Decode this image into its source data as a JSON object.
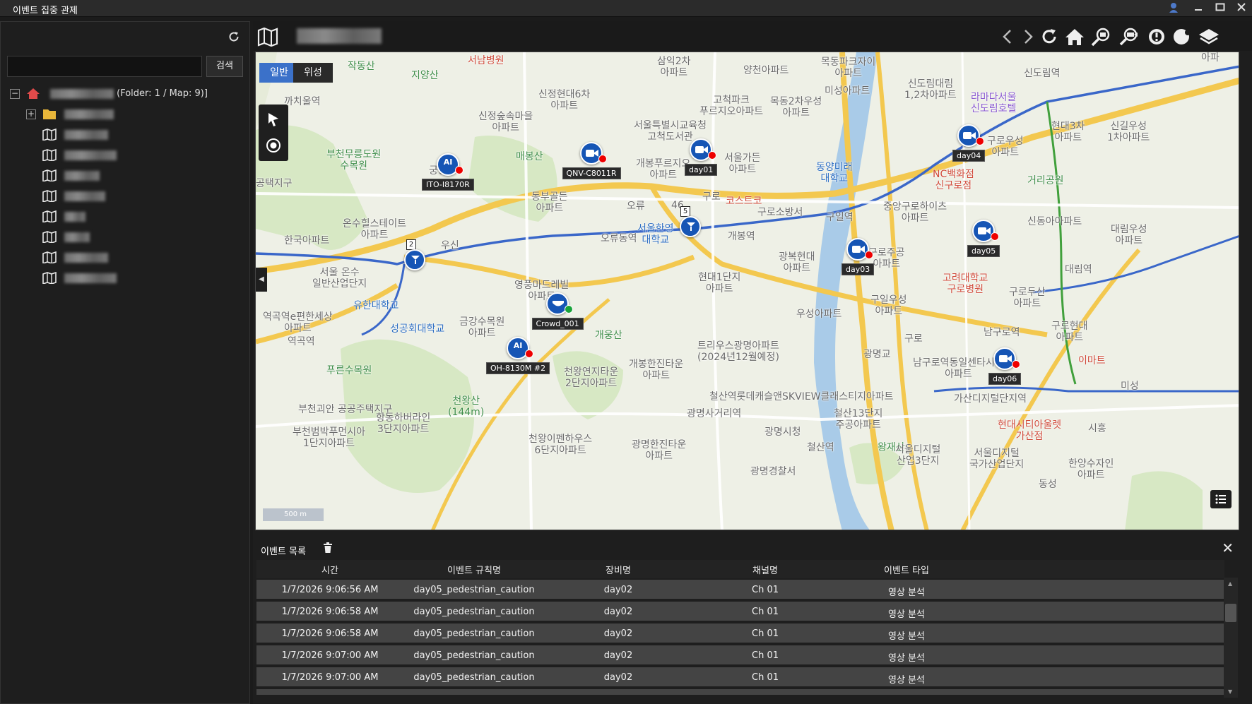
{
  "window": {
    "title": "이벤트 집중 관제",
    "controls": [
      "user-icon",
      "minimize-icon",
      "maximize-icon",
      "close-icon"
    ]
  },
  "sidebar": {
    "search_placeholder": "",
    "search_button": "검색",
    "root": {
      "suffix": "(Folder: 1 / Map: 9)]"
    },
    "items": [
      {
        "type": "folder",
        "label": ""
      },
      {
        "type": "map",
        "label": ""
      },
      {
        "type": "map",
        "label": ""
      },
      {
        "type": "map",
        "label": ""
      },
      {
        "type": "map",
        "label": ""
      },
      {
        "type": "map",
        "label": ""
      },
      {
        "type": "map",
        "label": ""
      },
      {
        "type": "map",
        "label": ""
      },
      {
        "type": "map",
        "label": ""
      }
    ]
  },
  "toolbar": {
    "icons": [
      "map-icon",
      "back-icon",
      "forward-icon",
      "refresh-icon",
      "home-icon",
      "zoom-search-icon",
      "camera-search-icon",
      "alarm-icon",
      "face-icon",
      "layers-icon"
    ]
  },
  "map": {
    "tabs": {
      "normal": "일반",
      "satellite": "위성"
    },
    "scale": "500 m",
    "places": [
      {
        "text": "작동산",
        "cls": "green"
      },
      {
        "text": "서남병원",
        "cls": "red"
      },
      {
        "text": "지양산",
        "cls": "green"
      },
      {
        "text": "삼익2차\n아파트",
        "cls": ""
      },
      {
        "text": "양천아파트",
        "cls": ""
      },
      {
        "text": "목동파크자이\n아파트",
        "cls": ""
      },
      {
        "text": "신도림대림\n1,2차아파트",
        "cls": ""
      },
      {
        "text": "신도림역",
        "cls": ""
      },
      {
        "text": "까치울역",
        "cls": ""
      },
      {
        "text": "신정현대6차\n아파트",
        "cls": ""
      },
      {
        "text": "미성아파트",
        "cls": ""
      },
      {
        "text": "고척파크\n푸르지오아파트",
        "cls": ""
      },
      {
        "text": "목동2차우성\n아파트",
        "cls": ""
      },
      {
        "text": "라마다서울\n신도림호텔",
        "cls": "purple"
      },
      {
        "text": "현대3차\n아파트",
        "cls": ""
      },
      {
        "text": "신길우성\n1차아파트",
        "cls": ""
      },
      {
        "text": "신정숲속마을\n아파트",
        "cls": ""
      },
      {
        "text": "서울특별시교육청\n고척도서관",
        "cls": ""
      },
      {
        "text": "부천무릉도원\n수목원",
        "cls": "green"
      },
      {
        "text": "매봉산",
        "cls": "green"
      },
      {
        "text": "개봉푸르지오\n아파트",
        "cls": ""
      },
      {
        "text": "서울가든\n아파트",
        "cls": ""
      },
      {
        "text": "동양미래\n대학교",
        "cls": "blue"
      },
      {
        "text": "구로우성\n아파트",
        "cls": ""
      },
      {
        "text": "NC백화점\n신구로점",
        "cls": "red"
      },
      {
        "text": "거리공원",
        "cls": "green"
      },
      {
        "text": "궁동",
        "cls": ""
      },
      {
        "text": "동부골든\n아파트",
        "cls": ""
      },
      {
        "text": "오류",
        "cls": ""
      },
      {
        "text": "구로",
        "cls": ""
      },
      {
        "text": "코스트코",
        "cls": "red"
      },
      {
        "text": "구로소방서",
        "cls": ""
      },
      {
        "text": "구일역",
        "cls": ""
      },
      {
        "text": "중앙구로하이츠\n아파트",
        "cls": ""
      },
      {
        "text": "신동아아파트",
        "cls": ""
      },
      {
        "text": "대림우성\n아파트",
        "cls": ""
      },
      {
        "text": "공택지구",
        "cls": ""
      },
      {
        "text": "온수힐스테이트\n아파트",
        "cls": ""
      },
      {
        "text": "오류동역",
        "cls": ""
      },
      {
        "text": "서울한영\n대학교",
        "cls": "blue"
      },
      {
        "text": "개봉역",
        "cls": ""
      },
      {
        "text": "구로주공\n아파트",
        "cls": ""
      },
      {
        "text": "한국아파트",
        "cls": ""
      },
      {
        "text": "우신",
        "cls": ""
      },
      {
        "text": "광복현대\n아파트",
        "cls": ""
      },
      {
        "text": "서울 온수\n일반산업단지",
        "cls": ""
      },
      {
        "text": "영풍마드레빌\n아파트",
        "cls": ""
      },
      {
        "text": "현대1단지\n아파트",
        "cls": ""
      },
      {
        "text": "고려대학교\n구로병원",
        "cls": "red"
      },
      {
        "text": "대림역",
        "cls": ""
      },
      {
        "text": "구로두산\n아파트",
        "cls": ""
      },
      {
        "text": "구일우성\n아파트",
        "cls": ""
      },
      {
        "text": "유한대학교",
        "cls": "blue"
      },
      {
        "text": "역곡역e편한세상\n아파트",
        "cls": ""
      },
      {
        "text": "성공회대학교",
        "cls": "blue"
      },
      {
        "text": "금강수목원\n아파트",
        "cls": ""
      },
      {
        "text": "우성아파트",
        "cls": ""
      },
      {
        "text": "개웅산",
        "cls": "green"
      },
      {
        "text": "남구로역",
        "cls": ""
      },
      {
        "text": "구로현대\n아파트",
        "cls": ""
      },
      {
        "text": "역곡역",
        "cls": ""
      },
      {
        "text": "구로",
        "cls": ""
      },
      {
        "text": "트리우스광명아파트\n(2024년12월예정)",
        "cls": ""
      },
      {
        "text": "광명교",
        "cls": ""
      },
      {
        "text": "남구로역동일센타시아\n아파트",
        "cls": ""
      },
      {
        "text": "이마트",
        "cls": "red"
      },
      {
        "text": "푸른수목원",
        "cls": "green"
      },
      {
        "text": "개봉한진타운\n아파트",
        "cls": ""
      },
      {
        "text": "천왕연지타운\n2단지아파트",
        "cls": ""
      },
      {
        "text": "미성",
        "cls": ""
      },
      {
        "text": "철산역롯데캐슬앤SKVIEW클래스티지아파트",
        "cls": ""
      },
      {
        "text": "가산디지털단지역",
        "cls": ""
      },
      {
        "text": "천왕산\n(144m)",
        "cls": "green"
      },
      {
        "text": "부천괴안 공공주택지구",
        "cls": ""
      },
      {
        "text": "광명사거리역",
        "cls": ""
      },
      {
        "text": "철산13단지\n주공아파트",
        "cls": ""
      },
      {
        "text": "항동하버라인\n3단지아파트",
        "cls": ""
      },
      {
        "text": "광명시청",
        "cls": ""
      },
      {
        "text": "현대시티아울렛\n가산점",
        "cls": "red"
      },
      {
        "text": "시흥",
        "cls": ""
      },
      {
        "text": "부천범박푸먼시아\n1단지아파트",
        "cls": ""
      },
      {
        "text": "천왕이펜하우스\n6단지아파트",
        "cls": ""
      },
      {
        "text": "광명한진타운\n아파트",
        "cls": ""
      },
      {
        "text": "철산역",
        "cls": ""
      },
      {
        "text": "왕재산",
        "cls": "green"
      },
      {
        "text": "서울디지털\n산업3단지",
        "cls": ""
      },
      {
        "text": "서울디지털\n국가산업단지",
        "cls": ""
      },
      {
        "text": "한양수자인\n아파트",
        "cls": ""
      },
      {
        "text": "광명경찰서",
        "cls": ""
      },
      {
        "text": "46",
        "cls": ""
      },
      {
        "text": "아파",
        "cls": ""
      },
      {
        "text": "동성",
        "cls": ""
      }
    ],
    "devices": [
      {
        "label": "ITO-I8170R",
        "icon": "ai-camera-icon",
        "status": "alarm"
      },
      {
        "label": "QNV-C8011R",
        "icon": "camera-icon",
        "status": "alarm"
      },
      {
        "label": "day01",
        "icon": "camera-icon",
        "status": "alarm"
      },
      {
        "label": "day04",
        "icon": "camera-icon",
        "status": "alarm"
      },
      {
        "label": "day03",
        "icon": "camera-icon",
        "status": "alarm"
      },
      {
        "label": "day05",
        "icon": "camera-icon",
        "status": "alarm"
      },
      {
        "label": "Crowd_001",
        "icon": "dome-camera-icon",
        "status": "normal"
      },
      {
        "label": "OH-8130M #2",
        "icon": "ai-camera-icon",
        "status": "alarm"
      },
      {
        "label": "day06",
        "icon": "camera-icon",
        "status": "alarm"
      }
    ],
    "groups": [
      {
        "count": "2"
      },
      {
        "count": "5"
      }
    ]
  },
  "events": {
    "title": "이벤트 목록",
    "columns": [
      "시간",
      "이벤트 규칙명",
      "장비명",
      "채널명",
      "이벤트 타입"
    ],
    "rows": [
      [
        "1/7/2026 9:06:56 AM",
        "day05_pedestrian_caution",
        "day02",
        "Ch 01",
        "영상 분석"
      ],
      [
        "1/7/2026 9:06:58 AM",
        "day05_pedestrian_caution",
        "day02",
        "Ch 01",
        "영상 분석"
      ],
      [
        "1/7/2026 9:06:58 AM",
        "day05_pedestrian_caution",
        "day02",
        "Ch 01",
        "영상 분석"
      ],
      [
        "1/7/2026 9:07:00 AM",
        "day05_pedestrian_caution",
        "day02",
        "Ch 01",
        "영상 분석"
      ],
      [
        "1/7/2026 9:07:00 AM",
        "day05_pedestrian_caution",
        "day02",
        "Ch 01",
        "영상 분석"
      ]
    ]
  }
}
